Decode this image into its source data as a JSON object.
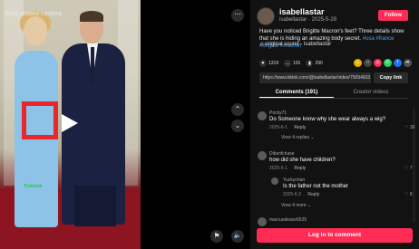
{
  "media": {
    "related_label": "Find related content",
    "watermark": "Ticktock"
  },
  "controls": {
    "more": "⋯",
    "up": "⌃",
    "down": "⌄",
    "report": "⚑",
    "volume": "🔈"
  },
  "author": {
    "username": "isabellastar",
    "subline": "isabellastar · 2025-5-28",
    "follow_label": "Follow"
  },
  "caption": {
    "text": "Have you noticed Brigitte Macron's feet? Three details show that she is hiding an amazing body secret.",
    "hashtags": "#usa #france #brigitte #macron"
  },
  "sound": "♫ original sound - isabellastar",
  "actions": {
    "likes": "1319",
    "comments": "191",
    "saves": "290"
  },
  "share": {
    "url": "https://www.tiktok.com/@isabellastar/video/75094603...",
    "copy_label": "Copy link",
    "icons": [
      "embed-icon",
      "whatsapp-icon",
      "facebook-icon",
      "twitter-icon",
      "more-share-icon"
    ]
  },
  "tabs": {
    "comments": "Comments (191)",
    "creator": "Creator videos"
  },
  "comments": [
    {
      "user": "Pocky71",
      "text": "Do Someone know why she wear always a wig?",
      "date": "2025-6-1",
      "reply": "Reply",
      "likes": "36",
      "view": "View 4 replies ⌄"
    },
    {
      "user": "Dibsnfchase",
      "text": "how did she have children?",
      "date": "2025-6-1",
      "reply": "Reply",
      "likes": "7",
      "view": ""
    },
    {
      "user": "Yuckychan",
      "text": "Is the father not the mother",
      "date": "2025-6-2",
      "reply": "Reply",
      "likes": "8",
      "view": "View 4 more ⌄"
    },
    {
      "user": "marcusdeace6525",
      "text": "",
      "date": "",
      "reply": "",
      "likes": "",
      "view": ""
    }
  ],
  "login": {
    "label": "Log in to comment"
  }
}
